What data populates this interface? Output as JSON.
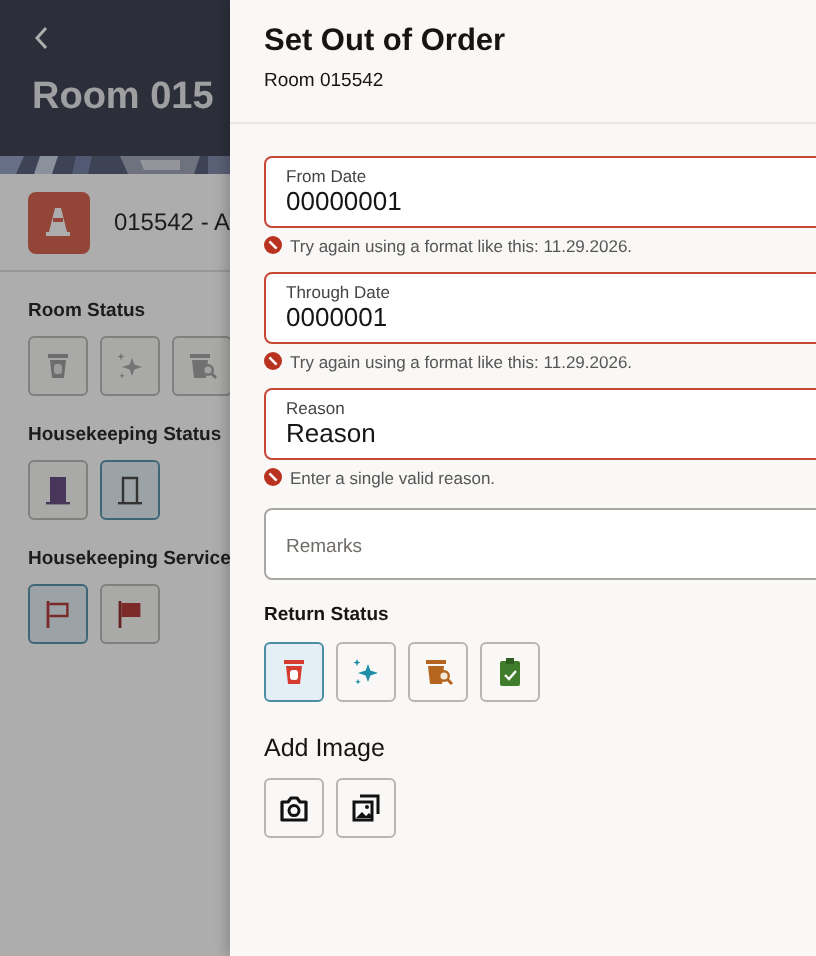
{
  "background": {
    "title": "Room 015",
    "room_label": "015542 - A",
    "sections": [
      {
        "label": "Room Status",
        "buttons": [
          {
            "kind": "bin",
            "selected": false,
            "disabled": true
          },
          {
            "kind": "sparkle",
            "selected": false,
            "disabled": true
          },
          {
            "kind": "bin-search",
            "selected": false,
            "disabled": true
          }
        ]
      },
      {
        "label": "Housekeeping Status",
        "buttons": [
          {
            "kind": "door-filled",
            "selected": false,
            "disabled": false
          },
          {
            "kind": "door-outline",
            "selected": true,
            "disabled": false
          }
        ]
      },
      {
        "label": "Housekeeping Service",
        "buttons": [
          {
            "kind": "flag-outline",
            "selected": true,
            "disabled": false
          },
          {
            "kind": "flag-filled",
            "selected": false,
            "disabled": false
          }
        ]
      }
    ]
  },
  "drawer": {
    "title": "Set Out of Order",
    "subtitle": "Room 015542",
    "fields": [
      {
        "label": "From Date",
        "value": "00000001",
        "invalid": true,
        "error": "Try again using a format like this: 11.29.2026."
      },
      {
        "label": "Through Date",
        "value": "0000001",
        "invalid": true,
        "error": "Try again using a format like this: 11.29.2026."
      },
      {
        "label": "Reason",
        "value": "Reason",
        "invalid": true,
        "error": "Enter a single valid reason."
      }
    ],
    "remarks": {
      "placeholder": "Remarks"
    },
    "return_status": {
      "label": "Return Status",
      "buttons": [
        {
          "kind": "bin-red",
          "selected": true,
          "disabled": false
        },
        {
          "kind": "sparkle",
          "selected": false,
          "disabled": false
        },
        {
          "kind": "bin-search",
          "selected": false,
          "disabled": false
        },
        {
          "kind": "clipboard",
          "selected": false,
          "disabled": false
        }
      ]
    },
    "add_image": {
      "label": "Add Image",
      "buttons": [
        {
          "kind": "camera",
          "selected": false,
          "disabled": false
        },
        {
          "kind": "gallery",
          "selected": false,
          "disabled": false
        }
      ]
    }
  }
}
